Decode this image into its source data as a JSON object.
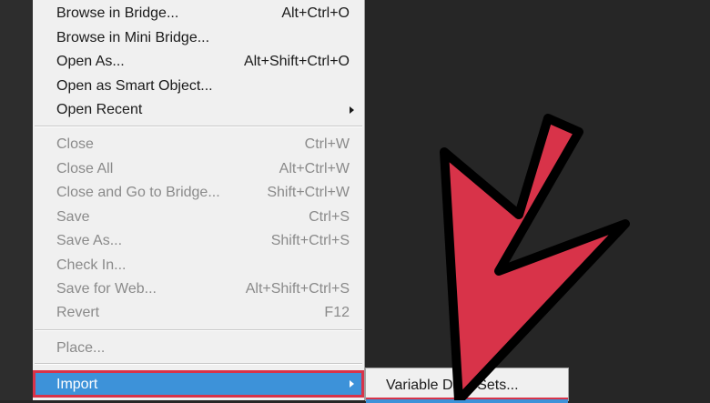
{
  "menu": {
    "items": [
      {
        "label": "Browse in Bridge...",
        "shortcut": "Alt+Ctrl+O"
      },
      {
        "label": "Browse in Mini Bridge...",
        "shortcut": ""
      },
      {
        "label": "Open As...",
        "shortcut": "Alt+Shift+Ctrl+O"
      },
      {
        "label": "Open as Smart Object...",
        "shortcut": ""
      },
      {
        "label": "Open Recent",
        "shortcut": ""
      },
      {
        "label": "Close",
        "shortcut": "Ctrl+W"
      },
      {
        "label": "Close All",
        "shortcut": "Alt+Ctrl+W"
      },
      {
        "label": "Close and Go to Bridge...",
        "shortcut": "Shift+Ctrl+W"
      },
      {
        "label": "Save",
        "shortcut": "Ctrl+S"
      },
      {
        "label": "Save As...",
        "shortcut": "Shift+Ctrl+S"
      },
      {
        "label": "Check In...",
        "shortcut": ""
      },
      {
        "label": "Save for Web...",
        "shortcut": "Alt+Shift+Ctrl+S"
      },
      {
        "label": "Revert",
        "shortcut": "F12"
      },
      {
        "label": "Place...",
        "shortcut": ""
      },
      {
        "label": "Import",
        "shortcut": ""
      }
    ]
  },
  "submenu": {
    "items": [
      {
        "label": "Variable Data Sets..."
      }
    ]
  },
  "colors": {
    "highlight": "#3d92d9",
    "annotation_red": "#d83349",
    "background": "#262626",
    "menu_bg": "#f0f0f0"
  }
}
